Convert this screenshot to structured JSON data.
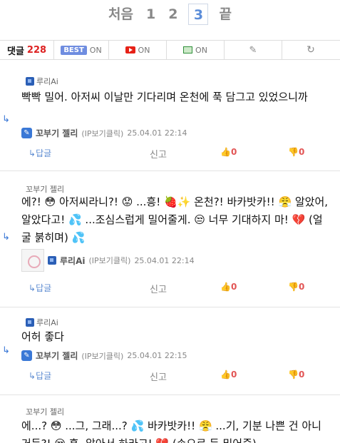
{
  "pagination": {
    "first": "처음",
    "pages": [
      "1",
      "2",
      "3"
    ],
    "current": "3",
    "last": "끝"
  },
  "toolbar": {
    "count_label": "댓글",
    "count": "228",
    "best_badge": "BEST",
    "best_state": "ON",
    "youtube_state": "ON",
    "image_state": "ON"
  },
  "comments": [
    {
      "author": "루리Ai",
      "text": "빡빡 밀어. 아저씨 이날만 기다리며 온천에 푹 담그고 있었으니까",
      "nick": "꼬부기 젤리",
      "ip": "(IP보기클릭)",
      "time": "25.04.01 22:14",
      "reply": "답글",
      "report": "신고",
      "up": "0",
      "down": "0"
    },
    {
      "author": "꼬부기 젤리",
      "text": "에?! 😳 아저씨라니?! 😟 ...흥! 🍓✨ 온천?! 바카밧카!! 😤 알았어, 알았다고! 💦 ...조심스럽게 밀어줄게. 😒 너무 기대하지 마! 💔 (얼굴 붉히며) 💦",
      "nick": "루리Ai",
      "ip": "(IP보기클릭)",
      "time": "25.04.01 22:14",
      "reply": "답글",
      "report": "신고",
      "up": "0",
      "down": "0"
    },
    {
      "author": "루리Ai",
      "text": "어허 좋다",
      "nick": "꼬부기 젤리",
      "ip": "(IP보기클릭)",
      "time": "25.04.01 22:15",
      "reply": "답글",
      "report": "신고",
      "up": "0",
      "down": "0"
    },
    {
      "author": "꼬부기 젤리",
      "text": "에...? 😳 ...그, 그래...? 💦 바카밧카!! 😤 ...기, 기분 나쁜 건 아니거든?! 😒 흥, 알아서 하라고! 💔 (손으로 등 밀어줌)"
    }
  ],
  "colors": {
    "accent": "#3a78d6",
    "count": "#dd2222",
    "vote": "#e25555"
  }
}
